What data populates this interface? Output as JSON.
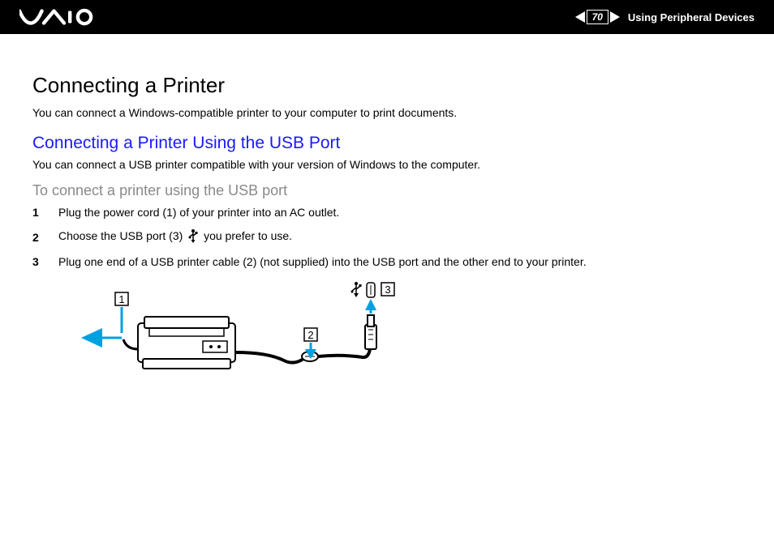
{
  "header": {
    "page_number": "70",
    "section": "Using Peripheral Devices",
    "logo_name": "VAIO"
  },
  "content": {
    "title": "Connecting a Printer",
    "intro": "You can connect a Windows-compatible printer to your computer to print documents.",
    "subtitle": "Connecting a Printer Using the USB Port",
    "subtitle_intro": "You can connect a USB printer compatible with your version of Windows to the computer.",
    "procedure_title": "To connect a printer using the USB port",
    "steps": [
      {
        "num": "1",
        "text": "Plug the power cord (1) of your printer into an AC outlet."
      },
      {
        "num": "2",
        "text_before": "Choose the USB port (3) ",
        "text_after": " you prefer to use."
      },
      {
        "num": "3",
        "text": "Plug one end of a USB printer cable (2) (not supplied) into the USB port and the other end to your printer."
      }
    ],
    "callouts": {
      "c1": "1",
      "c2": "2",
      "c3": "3"
    }
  }
}
